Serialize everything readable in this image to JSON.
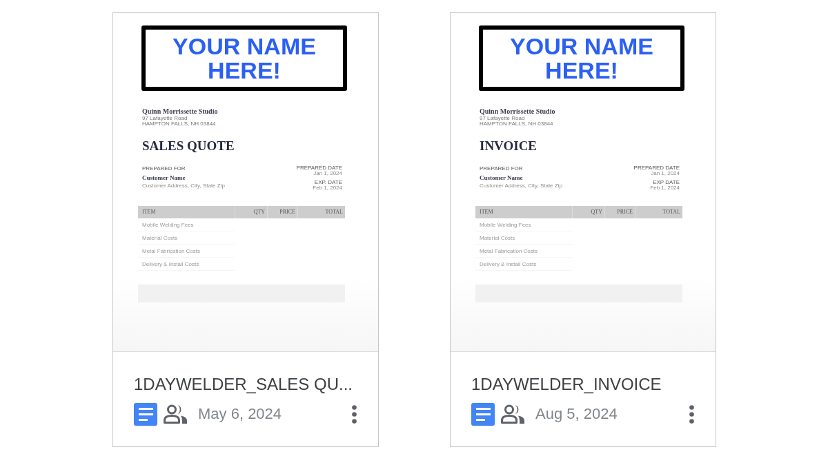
{
  "files": [
    {
      "kind": "document",
      "shared": true,
      "preview": {
        "banner": "YOUR NAME HERE!",
        "company": "Quinn Morrissette Studio",
        "address_lines": [
          "97 Lafayette Road",
          "HAMPTON FALLS, NH 03844"
        ],
        "title": "SALES QUOTE",
        "prepared_for_label": "PREPARED FOR",
        "customer_name": "Customer Name",
        "customer_address": "Customer Address, City, State Zip",
        "dates": [
          {
            "label": "PREPARED DATE",
            "value": "Jan 1, 2024"
          },
          {
            "label": "EXP. DATE",
            "value": "Feb 1, 2024"
          }
        ],
        "table": {
          "columns": [
            "ITEM",
            "QTY",
            "PRICE",
            "TOTAL"
          ],
          "rows": [
            {
              "item": "Mobile Welding Fees"
            },
            {
              "item": "Material Costs"
            },
            {
              "item": "Metal Fabrication Costs"
            },
            {
              "item": "Delivery & Install Costs"
            }
          ]
        }
      },
      "name": "1DAYWELDER_SALES QU...",
      "date": "May 6, 2024"
    },
    {
      "kind": "document",
      "shared": true,
      "preview": {
        "banner": "YOUR NAME HERE!",
        "company": "Quinn Morrissette Studio",
        "address_lines": [
          "97 Lafayette Road",
          "HAMPTON FALLS, NH 03844"
        ],
        "title": "INVOICE",
        "prepared_for_label": "PREPARED FOR",
        "customer_name": "Customer Name",
        "customer_address": "Customer Address, City, State Zip",
        "dates": [
          {
            "label": "PREPARED DATE",
            "value": "Jan 1, 2024"
          },
          {
            "label": "EXP DATE",
            "value": "Feb 1, 2024"
          }
        ],
        "table": {
          "columns": [
            "ITEM",
            "QTY",
            "PRICE",
            "TOTAL"
          ],
          "rows": [
            {
              "item": "Mobile Welding Fees"
            },
            {
              "item": "Material Costs"
            },
            {
              "item": "Metal Fabrication Costs"
            },
            {
              "item": "Delivery & Install Costs"
            }
          ]
        }
      },
      "name": "1DAYWELDER_INVOICE",
      "date": "Aug 5, 2024"
    }
  ]
}
